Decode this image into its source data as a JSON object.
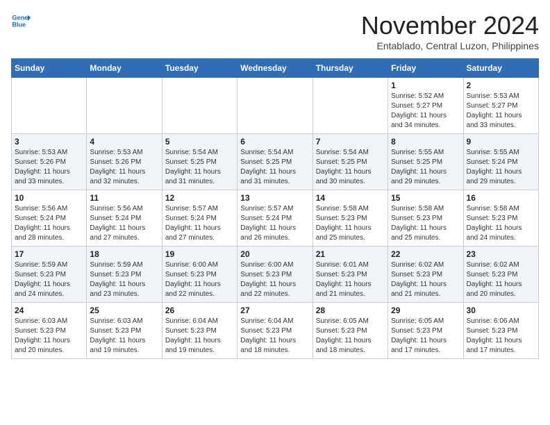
{
  "logo": {
    "line1": "General",
    "line2": "Blue"
  },
  "title": "November 2024",
  "subtitle": "Entablado, Central Luzon, Philippines",
  "weekdays": [
    "Sunday",
    "Monday",
    "Tuesday",
    "Wednesday",
    "Thursday",
    "Friday",
    "Saturday"
  ],
  "weeks": [
    [
      {
        "day": "",
        "info": ""
      },
      {
        "day": "",
        "info": ""
      },
      {
        "day": "",
        "info": ""
      },
      {
        "day": "",
        "info": ""
      },
      {
        "day": "",
        "info": ""
      },
      {
        "day": "1",
        "info": "Sunrise: 5:52 AM\nSunset: 5:27 PM\nDaylight: 11 hours\nand 34 minutes."
      },
      {
        "day": "2",
        "info": "Sunrise: 5:53 AM\nSunset: 5:27 PM\nDaylight: 11 hours\nand 33 minutes."
      }
    ],
    [
      {
        "day": "3",
        "info": "Sunrise: 5:53 AM\nSunset: 5:26 PM\nDaylight: 11 hours\nand 33 minutes."
      },
      {
        "day": "4",
        "info": "Sunrise: 5:53 AM\nSunset: 5:26 PM\nDaylight: 11 hours\nand 32 minutes."
      },
      {
        "day": "5",
        "info": "Sunrise: 5:54 AM\nSunset: 5:25 PM\nDaylight: 11 hours\nand 31 minutes."
      },
      {
        "day": "6",
        "info": "Sunrise: 5:54 AM\nSunset: 5:25 PM\nDaylight: 11 hours\nand 31 minutes."
      },
      {
        "day": "7",
        "info": "Sunrise: 5:54 AM\nSunset: 5:25 PM\nDaylight: 11 hours\nand 30 minutes."
      },
      {
        "day": "8",
        "info": "Sunrise: 5:55 AM\nSunset: 5:25 PM\nDaylight: 11 hours\nand 29 minutes."
      },
      {
        "day": "9",
        "info": "Sunrise: 5:55 AM\nSunset: 5:24 PM\nDaylight: 11 hours\nand 29 minutes."
      }
    ],
    [
      {
        "day": "10",
        "info": "Sunrise: 5:56 AM\nSunset: 5:24 PM\nDaylight: 11 hours\nand 28 minutes."
      },
      {
        "day": "11",
        "info": "Sunrise: 5:56 AM\nSunset: 5:24 PM\nDaylight: 11 hours\nand 27 minutes."
      },
      {
        "day": "12",
        "info": "Sunrise: 5:57 AM\nSunset: 5:24 PM\nDaylight: 11 hours\nand 27 minutes."
      },
      {
        "day": "13",
        "info": "Sunrise: 5:57 AM\nSunset: 5:24 PM\nDaylight: 11 hours\nand 26 minutes."
      },
      {
        "day": "14",
        "info": "Sunrise: 5:58 AM\nSunset: 5:23 PM\nDaylight: 11 hours\nand 25 minutes."
      },
      {
        "day": "15",
        "info": "Sunrise: 5:58 AM\nSunset: 5:23 PM\nDaylight: 11 hours\nand 25 minutes."
      },
      {
        "day": "16",
        "info": "Sunrise: 5:58 AM\nSunset: 5:23 PM\nDaylight: 11 hours\nand 24 minutes."
      }
    ],
    [
      {
        "day": "17",
        "info": "Sunrise: 5:59 AM\nSunset: 5:23 PM\nDaylight: 11 hours\nand 24 minutes."
      },
      {
        "day": "18",
        "info": "Sunrise: 5:59 AM\nSunset: 5:23 PM\nDaylight: 11 hours\nand 23 minutes."
      },
      {
        "day": "19",
        "info": "Sunrise: 6:00 AM\nSunset: 5:23 PM\nDaylight: 11 hours\nand 22 minutes."
      },
      {
        "day": "20",
        "info": "Sunrise: 6:00 AM\nSunset: 5:23 PM\nDaylight: 11 hours\nand 22 minutes."
      },
      {
        "day": "21",
        "info": "Sunrise: 6:01 AM\nSunset: 5:23 PM\nDaylight: 11 hours\nand 21 minutes."
      },
      {
        "day": "22",
        "info": "Sunrise: 6:02 AM\nSunset: 5:23 PM\nDaylight: 11 hours\nand 21 minutes."
      },
      {
        "day": "23",
        "info": "Sunrise: 6:02 AM\nSunset: 5:23 PM\nDaylight: 11 hours\nand 20 minutes."
      }
    ],
    [
      {
        "day": "24",
        "info": "Sunrise: 6:03 AM\nSunset: 5:23 PM\nDaylight: 11 hours\nand 20 minutes."
      },
      {
        "day": "25",
        "info": "Sunrise: 6:03 AM\nSunset: 5:23 PM\nDaylight: 11 hours\nand 19 minutes."
      },
      {
        "day": "26",
        "info": "Sunrise: 6:04 AM\nSunset: 5:23 PM\nDaylight: 11 hours\nand 19 minutes."
      },
      {
        "day": "27",
        "info": "Sunrise: 6:04 AM\nSunset: 5:23 PM\nDaylight: 11 hours\nand 18 minutes."
      },
      {
        "day": "28",
        "info": "Sunrise: 6:05 AM\nSunset: 5:23 PM\nDaylight: 11 hours\nand 18 minutes."
      },
      {
        "day": "29",
        "info": "Sunrise: 6:05 AM\nSunset: 5:23 PM\nDaylight: 11 hours\nand 17 minutes."
      },
      {
        "day": "30",
        "info": "Sunrise: 6:06 AM\nSunset: 5:23 PM\nDaylight: 11 hours\nand 17 minutes."
      }
    ]
  ]
}
